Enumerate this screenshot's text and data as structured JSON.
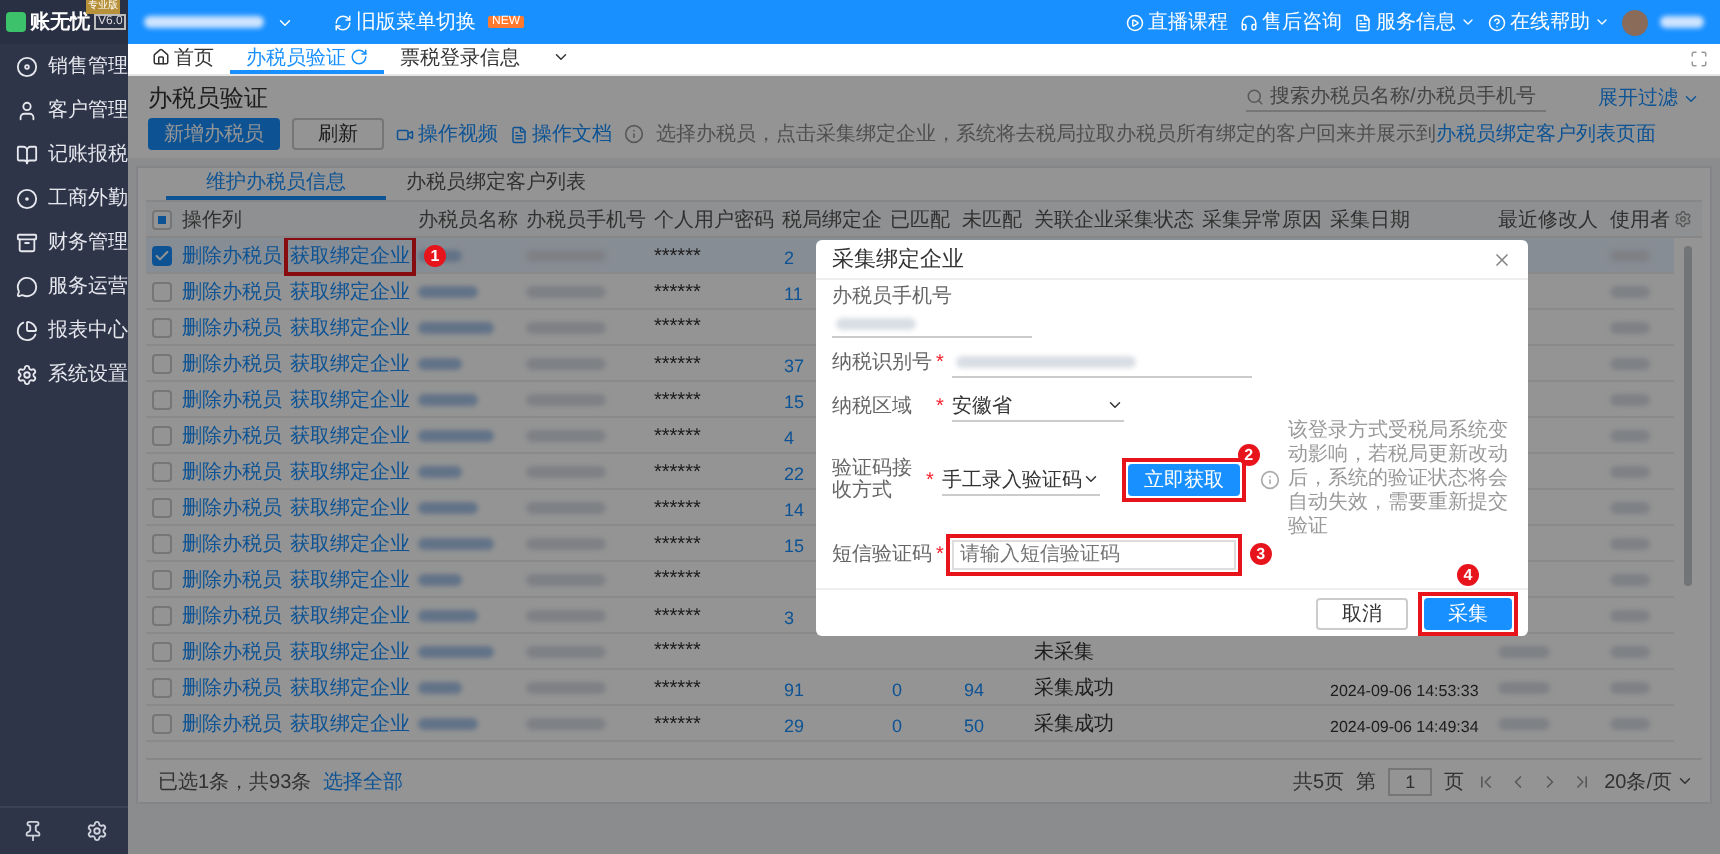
{
  "app": {
    "logo": "账无忧",
    "edition": "专业版",
    "version": "V6.0"
  },
  "topbar": {
    "menu_switch": "旧版菜单切换",
    "new_badge": "NEW",
    "links": [
      {
        "label": "直播课程",
        "dropdown": false
      },
      {
        "label": "售后咨询",
        "dropdown": false
      },
      {
        "label": "服务信息",
        "dropdown": true
      },
      {
        "label": "在线帮助",
        "dropdown": true
      }
    ]
  },
  "sidebar": {
    "items": [
      {
        "label": "销售管理"
      },
      {
        "label": "客户管理"
      },
      {
        "label": "记账报税"
      },
      {
        "label": "工商外勤"
      },
      {
        "label": "财务管理"
      },
      {
        "label": "服务运营"
      },
      {
        "label": "报表中心"
      },
      {
        "label": "系统设置"
      }
    ]
  },
  "tabs": [
    {
      "label": "首页",
      "selected": false
    },
    {
      "label": "办税员验证",
      "selected": true
    },
    {
      "label": "票税登录信息",
      "selected": false
    }
  ],
  "page": {
    "title": "办税员验证",
    "primary_button": "新增办税员",
    "refresh_button": "刷新",
    "video_link": "操作视频",
    "doc_link": "操作文档",
    "info": "选择办税员，点击采集绑定企业，系统将去税局拉取办税员所有绑定的客户回来并展示到",
    "info_link": "办税员绑定客户列表页面",
    "search_placeholder": "搜索办税员名称/办税员手机号",
    "filter_toggle": "展开过滤"
  },
  "subtabs": [
    {
      "label": "维护办税员信息",
      "selected": true
    },
    {
      "label": "办税员绑定客户列表",
      "selected": false
    }
  ],
  "table": {
    "header_partial": true,
    "columns": [
      "操作列",
      "办税员名称",
      "办税员手机号",
      "个人用户密码",
      "税局绑定企",
      "已匹配",
      "未匹配",
      "关联企业采集状态",
      "采集异常原因",
      "采集日期",
      "最近修改人",
      "使用者"
    ],
    "rows": [
      {
        "checked": true,
        "actions": [
          "删除办税员",
          "获取绑定企业"
        ],
        "marker": "1",
        "password": "******",
        "bound": "2"
      },
      {
        "checked": false,
        "actions": [
          "删除办税员",
          "获取绑定企业"
        ],
        "password": "******",
        "bound": "11"
      },
      {
        "checked": false,
        "actions": [
          "删除办税员",
          "获取绑定企业"
        ],
        "password": "******"
      },
      {
        "checked": false,
        "actions": [
          "删除办税员",
          "获取绑定企业"
        ],
        "password": "******",
        "bound": "37"
      },
      {
        "checked": false,
        "actions": [
          "删除办税员",
          "获取绑定企业"
        ],
        "password": "******",
        "bound": "15"
      },
      {
        "checked": false,
        "actions": [
          "删除办税员",
          "获取绑定企业"
        ],
        "password": "******",
        "bound": "4"
      },
      {
        "checked": false,
        "actions": [
          "删除办税员",
          "获取绑定企业"
        ],
        "password": "******",
        "bound": "22"
      },
      {
        "checked": false,
        "actions": [
          "删除办税员",
          "获取绑定企业"
        ],
        "password": "******",
        "bound": "14"
      },
      {
        "checked": false,
        "actions": [
          "删除办税员",
          "获取绑定企业"
        ],
        "password": "******",
        "bound": "15"
      },
      {
        "checked": false,
        "actions": [
          "删除办税员",
          "获取绑定企业"
        ],
        "password": "******"
      },
      {
        "checked": false,
        "actions": [
          "删除办税员",
          "获取绑定企业"
        ],
        "password": "******",
        "bound": "3"
      },
      {
        "checked": false,
        "actions": [
          "删除办税员",
          "获取绑定企业"
        ],
        "password": "******",
        "status": "未采集"
      },
      {
        "checked": false,
        "actions": [
          "删除办税员",
          "获取绑定企业"
        ],
        "password": "******",
        "bound": "91",
        "matched": "0",
        "unmatched": "94",
        "status": "采集成功",
        "date": "2024-09-06 14:53:33"
      },
      {
        "checked": false,
        "actions": [
          "删除办税员",
          "获取绑定企业"
        ],
        "password": "******",
        "bound": "29",
        "matched": "0",
        "unmatched": "50",
        "status": "采集成功",
        "date": "2024-09-06 14:49:34"
      }
    ]
  },
  "footer": {
    "selection": "已选1条，共93条",
    "select_all": "选择全部",
    "pages": "共5页",
    "page_prefix": "第",
    "page": "1",
    "page_suffix": "页",
    "page_size": "20条/页"
  },
  "modal": {
    "title": "采集绑定企业",
    "fields": [
      {
        "kind": "readonly",
        "label": "办税员手机号"
      },
      {
        "kind": "text",
        "label": "纳税识别号",
        "required_mark": "*"
      },
      {
        "kind": "select",
        "label": "纳税区域",
        "required_mark": "*",
        "value": "安徽省"
      },
      {
        "kind": "code",
        "label": "验证码接收方式",
        "required_mark": "*",
        "value": "手工录入验证码",
        "button": "立即获取",
        "button_marker": "2",
        "note": "该登录方式受税局系统变动影响，若税局更新改动后，系统的验证状态将会自动失效，需要重新提交验证"
      },
      {
        "kind": "input",
        "label": "短信验证码",
        "required_mark": "*",
        "placeholder": "请输入短信验证码",
        "marker": "3"
      }
    ],
    "cancel": "取消",
    "submit": "采集",
    "submit_marker": "4"
  }
}
